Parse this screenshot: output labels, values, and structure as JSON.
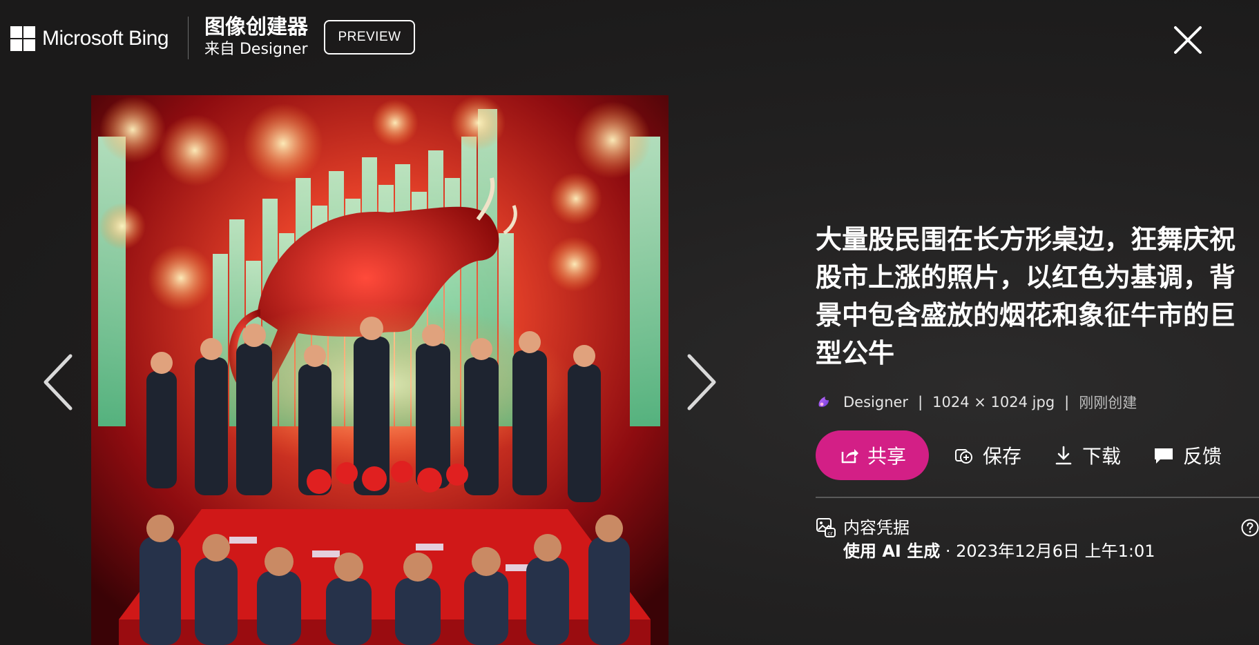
{
  "header": {
    "brand_name": "Microsoft Bing",
    "product_title": "图像创建器",
    "product_subtitle": "来自 Designer",
    "preview_label": "PREVIEW",
    "close_icon": "close-icon"
  },
  "navigation": {
    "prev_icon": "chevron-left-icon",
    "next_icon": "chevron-right-icon"
  },
  "image": {
    "subject": "generated-image",
    "accent_colors": [
      "#c8101a",
      "#7ee0a8",
      "#ffcc66"
    ]
  },
  "details": {
    "prompt": "大量股民围在长方形桌边，狂舞庆祝股市上涨的照片，以红色为基调，背景中包含盛放的烟花和象征牛市的巨型公牛",
    "meta": {
      "source": "Designer",
      "separator": "|",
      "resolution": "1024 × 1024 jpg",
      "created": "刚刚创建"
    },
    "actions": {
      "share": "共享",
      "save": "保存",
      "download": "下载",
      "feedback": "反馈"
    },
    "credentials": {
      "title": "内容凭据",
      "generated_by": "使用 AI 生成",
      "timestamp": " · 2023年12月6日 上午1:01"
    }
  },
  "colors": {
    "background": "#1b1a1a",
    "share_button": "#d31f86",
    "text": "#ffffff",
    "muted_text": "#bdbdbd"
  }
}
